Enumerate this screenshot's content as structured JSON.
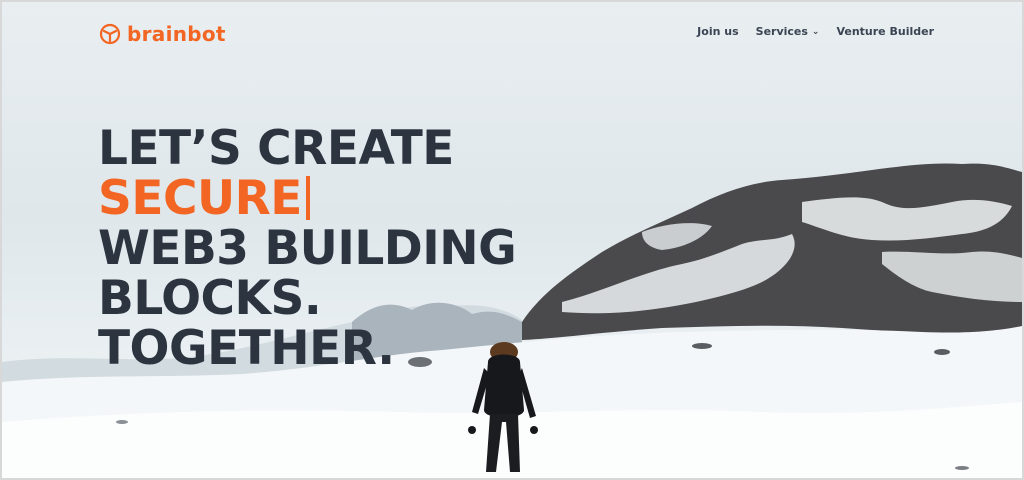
{
  "brand": {
    "name": "brainbot",
    "accent_color": "#f26522",
    "text_color": "#2c3440"
  },
  "nav": {
    "items": [
      {
        "label": "Join us",
        "has_dropdown": false
      },
      {
        "label": "Services",
        "has_dropdown": true
      },
      {
        "label": "Venture Builder",
        "has_dropdown": false
      }
    ]
  },
  "hero": {
    "line1": "LET’S CREATE",
    "highlight": "SECURE",
    "line3": "WEB3 BUILDING",
    "line4": "BLOCKS.",
    "line5": "TOGETHER."
  },
  "icons": {
    "logo": "brainbot-logo-icon",
    "dropdown": "chevron-down-icon"
  }
}
